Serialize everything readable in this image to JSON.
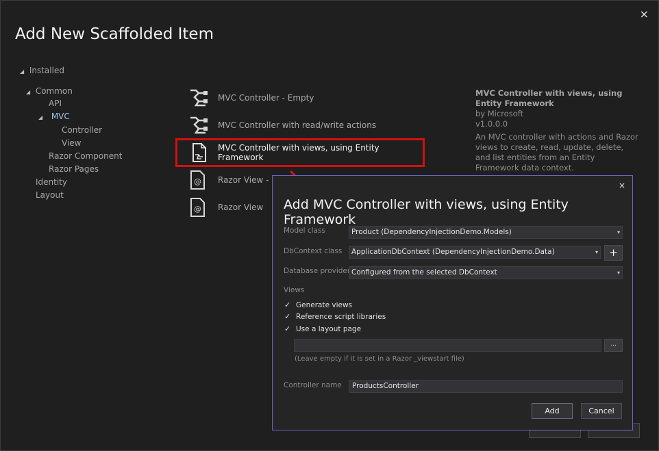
{
  "window": {
    "title": "Add New Scaffolded Item",
    "close_glyph": "×"
  },
  "tree": {
    "installed": "Installed",
    "common": "Common",
    "api": "API",
    "mvc": "MVC",
    "controller": "Controller",
    "view": "View",
    "razor_component": "Razor Component",
    "razor_pages": "Razor Pages",
    "identity": "Identity",
    "layout": "Layout"
  },
  "templates": [
    {
      "label": "MVC Controller - Empty",
      "icon": "controller-icon"
    },
    {
      "label": "MVC Controller with read/write actions",
      "icon": "controller-icon"
    },
    {
      "label": "MVC Controller with views, using Entity Framework",
      "icon": "controller-views-icon"
    },
    {
      "label": "Razor View - E",
      "icon": "razor-view-icon"
    },
    {
      "label": "Razor View",
      "icon": "razor-view-icon"
    }
  ],
  "description": {
    "title": "MVC Controller with views, using Entity Framework",
    "author": "by Microsoft",
    "version": "v1.0.0.0",
    "text": "An MVC controller with actions and Razor views to create, read, update, delete, and list entities from an Entity Framework data context."
  },
  "dialog": {
    "title": "Add MVC Controller with views, using Entity Framework",
    "close_glyph": "×",
    "model_class_label": "Model class",
    "model_class_value": "Product (DependencyInjectionDemo.Models)",
    "dbcontext_label": "DbContext class",
    "dbcontext_value": "ApplicationDbContext (DependencyInjectionDemo.Data)",
    "plus_label": "+",
    "provider_label": "Database provider",
    "provider_value": "Configured from the selected DbContext",
    "views_label": "Views",
    "generate_views": "Generate views",
    "reference_scripts": "Reference script libraries",
    "use_layout": "Use a layout page",
    "layout_value": "",
    "browse_label": "...",
    "layout_hint": "(Leave empty if it is set in a Razor _viewstart file)",
    "controller_name_label": "Controller name",
    "controller_name_value": "ProductsController",
    "add_label": "Add",
    "cancel_label": "Cancel",
    "checked_glyph": "✓",
    "caret_glyph": "▾"
  },
  "colors": {
    "background": "#1f1f1f",
    "dialog_background": "#252526",
    "dialog_border": "#6c66c2",
    "highlight_red": "#d40f0f",
    "selected_tree": "#9ec3e6"
  }
}
